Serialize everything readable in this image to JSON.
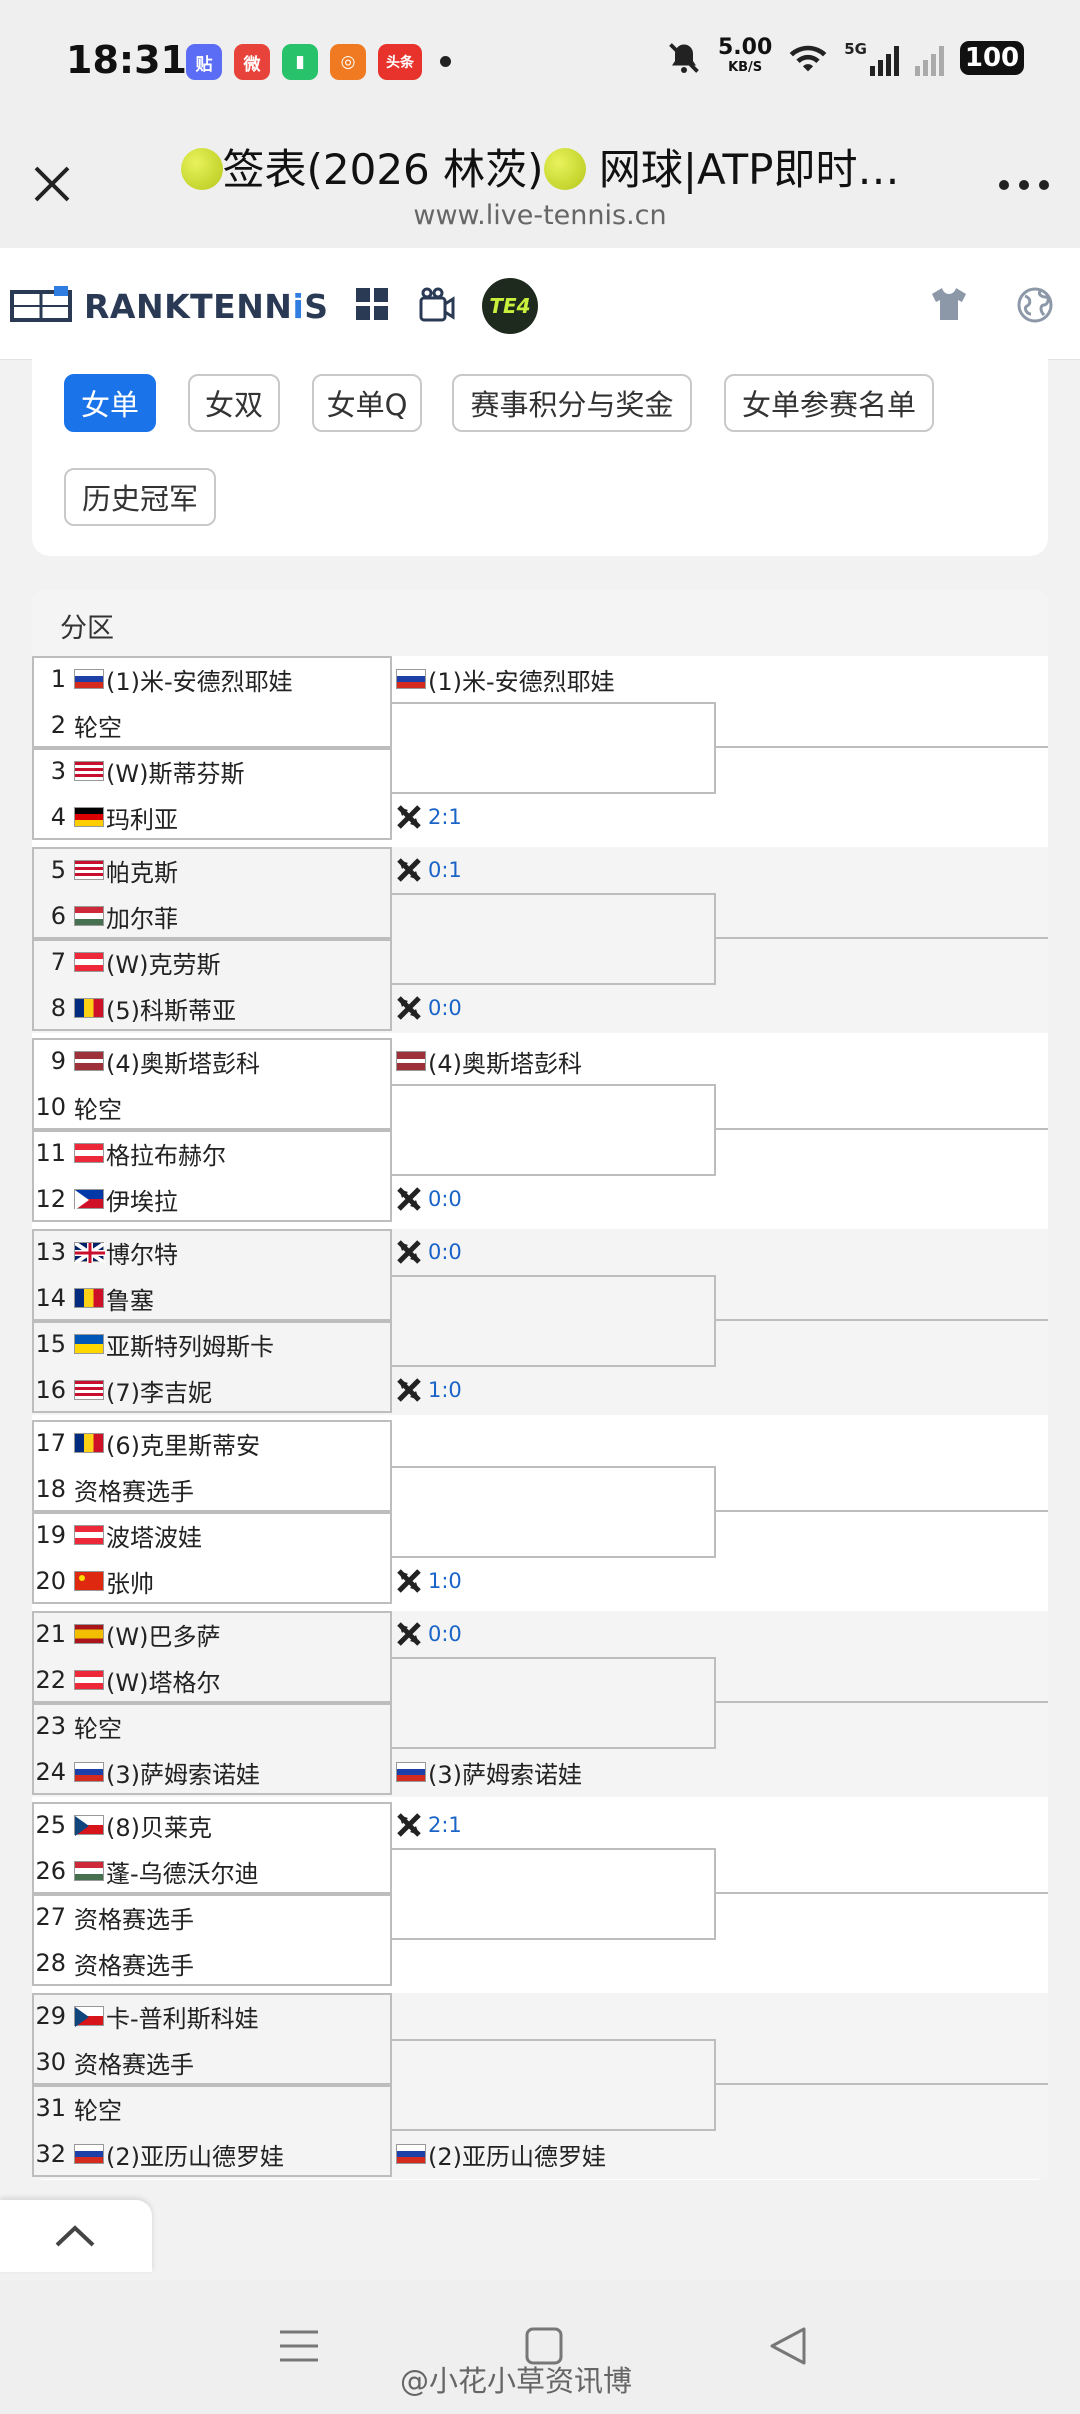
{
  "status": {
    "time": "18:31",
    "apps": [
      {
        "label": "贴",
        "color": "#5b6cf5"
      },
      {
        "label": "微",
        "color": "#e8433a"
      },
      {
        "label": "▮",
        "color": "#27c26a"
      },
      {
        "label": "◎",
        "color": "#f07a22"
      },
      {
        "label": "头条",
        "color": "#e8332d"
      }
    ],
    "speed": "5.00",
    "speed_unit": "KB/S",
    "net": "5G",
    "battery": "100"
  },
  "browser": {
    "title": "签表(2026 林茨) 网球|ATP即时...",
    "title_part1": "签表(2026 林茨)",
    "title_part2": " 网球|ATP即时…",
    "url": "www.live-tennis.cn"
  },
  "site": {
    "logo_main": "RANKTENN",
    "logo_i": "i",
    "logo_tail": "S",
    "te4": "TE4"
  },
  "tabs": [
    "女单",
    "女双",
    "女单Q",
    "赛事积分与奖金",
    "女单参赛名单",
    "历史冠军"
  ],
  "draw": {
    "header": "分区",
    "sections": [
      {
        "players": [
          {
            "num": "1",
            "flag": "ru",
            "name": "(1)米-安德烈耶娃"
          },
          {
            "num": "2",
            "flag": "",
            "name": "轮空"
          },
          {
            "num": "3",
            "flag": "us",
            "name": "(W)斯蒂芬斯"
          },
          {
            "num": "4",
            "flag": "de",
            "name": "玛利亚"
          }
        ],
        "r2_top": {
          "flag": "ru",
          "name": "(1)米-安德烈耶娃",
          "score": ""
        },
        "r2_bot": {
          "flag": "",
          "name": "",
          "score": "2:1"
        }
      },
      {
        "players": [
          {
            "num": "5",
            "flag": "us",
            "name": "帕克斯"
          },
          {
            "num": "6",
            "flag": "hu",
            "name": "加尔菲"
          },
          {
            "num": "7",
            "flag": "at",
            "name": "(W)克劳斯"
          },
          {
            "num": "8",
            "flag": "ro",
            "name": "(5)科斯蒂亚"
          }
        ],
        "r2_top": {
          "flag": "",
          "name": "",
          "score": "0:1"
        },
        "r2_bot": {
          "flag": "",
          "name": "",
          "score": "0:0"
        }
      },
      {
        "players": [
          {
            "num": "9",
            "flag": "lv",
            "name": "(4)奥斯塔彭科"
          },
          {
            "num": "10",
            "flag": "",
            "name": "轮空"
          },
          {
            "num": "11",
            "flag": "at",
            "name": "格拉布赫尔"
          },
          {
            "num": "12",
            "flag": "ph",
            "name": "伊埃拉"
          }
        ],
        "r2_top": {
          "flag": "lv",
          "name": "(4)奥斯塔彭科",
          "score": ""
        },
        "r2_bot": {
          "flag": "",
          "name": "",
          "score": "0:0"
        }
      },
      {
        "players": [
          {
            "num": "13",
            "flag": "gb",
            "name": "博尔特"
          },
          {
            "num": "14",
            "flag": "ro",
            "name": "鲁塞"
          },
          {
            "num": "15",
            "flag": "ua",
            "name": "亚斯特列姆斯卡"
          },
          {
            "num": "16",
            "flag": "us",
            "name": "(7)李吉妮"
          }
        ],
        "r2_top": {
          "flag": "",
          "name": "",
          "score": "0:0"
        },
        "r2_bot": {
          "flag": "",
          "name": "",
          "score": "1:0"
        }
      },
      {
        "players": [
          {
            "num": "17",
            "flag": "ro",
            "name": "(6)克里斯蒂安"
          },
          {
            "num": "18",
            "flag": "",
            "name": "资格赛选手"
          },
          {
            "num": "19",
            "flag": "at",
            "name": "波塔波娃"
          },
          {
            "num": "20",
            "flag": "cn",
            "name": "张帅"
          }
        ],
        "r2_top": {
          "flag": "",
          "name": "",
          "score": ""
        },
        "r2_bot": {
          "flag": "",
          "name": "",
          "score": "1:0"
        }
      },
      {
        "players": [
          {
            "num": "21",
            "flag": "es",
            "name": "(W)巴多萨"
          },
          {
            "num": "22",
            "flag": "at",
            "name": "(W)塔格尔"
          },
          {
            "num": "23",
            "flag": "",
            "name": "轮空"
          },
          {
            "num": "24",
            "flag": "ru",
            "name": "(3)萨姆索诺娃"
          }
        ],
        "r2_top": {
          "flag": "",
          "name": "",
          "score": "0:0"
        },
        "r2_bot": {
          "flag": "ru",
          "name": "(3)萨姆索诺娃",
          "score": ""
        }
      },
      {
        "players": [
          {
            "num": "25",
            "flag": "cz",
            "name": "(8)贝莱克"
          },
          {
            "num": "26",
            "flag": "hu",
            "name": "蓬-乌德沃尔迪"
          },
          {
            "num": "27",
            "flag": "",
            "name": "资格赛选手"
          },
          {
            "num": "28",
            "flag": "",
            "name": "资格赛选手"
          }
        ],
        "r2_top": {
          "flag": "",
          "name": "",
          "score": "2:1"
        },
        "r2_bot": {
          "flag": "",
          "name": "",
          "score": ""
        }
      },
      {
        "players": [
          {
            "num": "29",
            "flag": "cz",
            "name": "卡-普利斯科娃"
          },
          {
            "num": "30",
            "flag": "",
            "name": "资格赛选手"
          },
          {
            "num": "31",
            "flag": "",
            "name": "轮空"
          },
          {
            "num": "32",
            "flag": "ru",
            "name": "(2)亚历山德罗娃"
          }
        ],
        "r2_top": {
          "flag": "",
          "name": "",
          "score": ""
        },
        "r2_bot": {
          "flag": "ru",
          "name": "(2)亚历山德罗娃",
          "score": ""
        }
      }
    ]
  },
  "watermark": "@小花小草资讯博",
  "colors": {
    "accent": "#1a73e8",
    "score": "#1a64c8"
  }
}
